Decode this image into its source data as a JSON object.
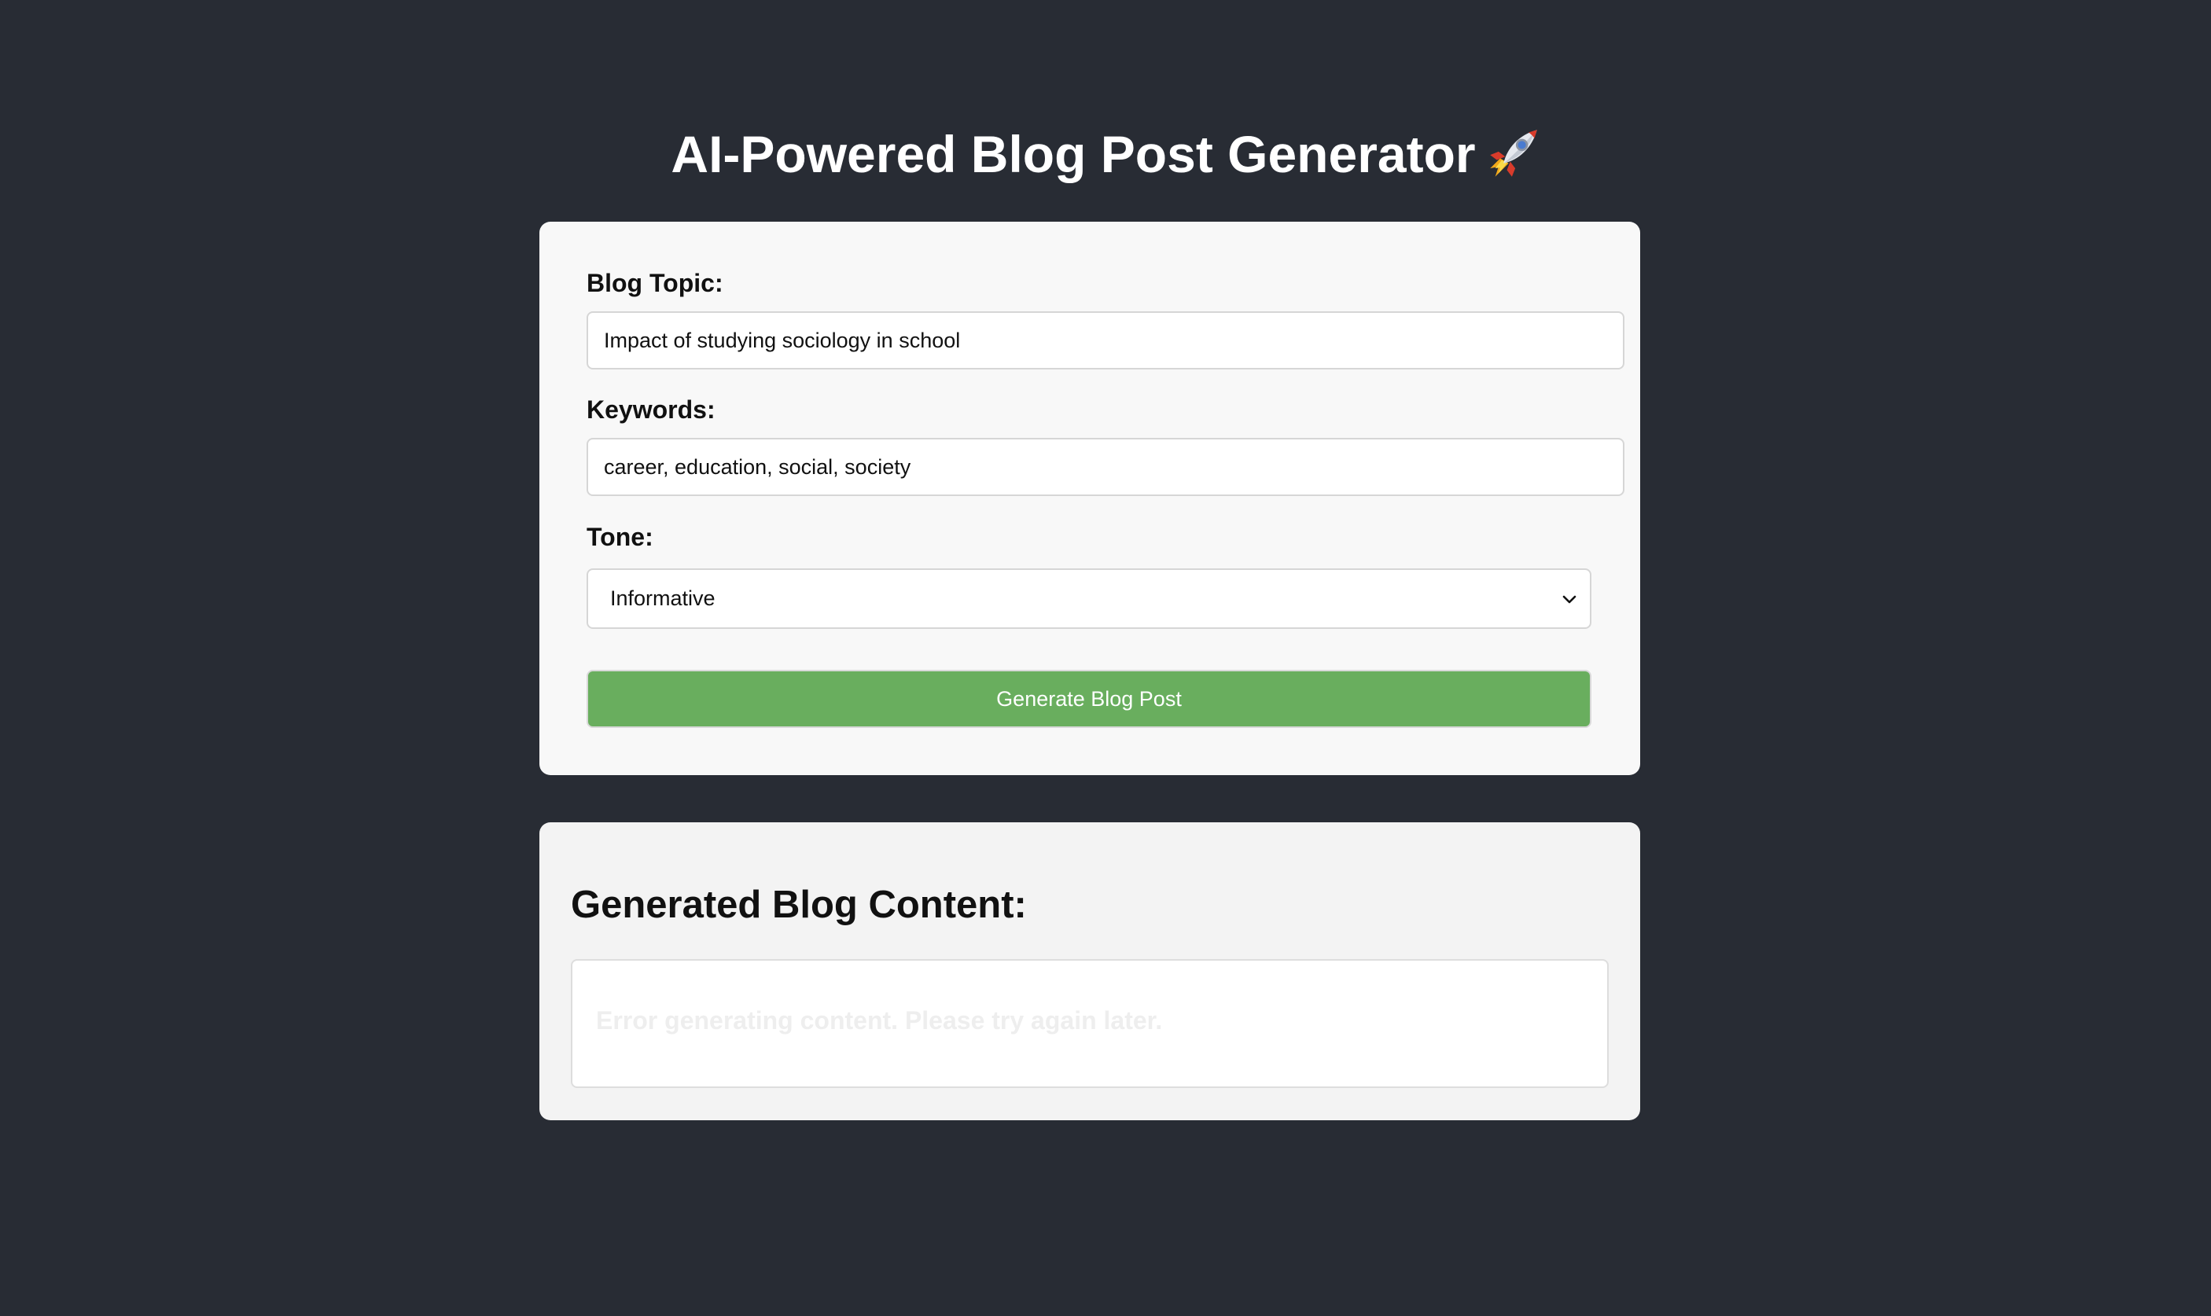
{
  "header": {
    "title": "AI-Powered Blog Post Generator",
    "title_icon": "rocket-icon"
  },
  "form": {
    "topic": {
      "label": "Blog Topic:",
      "value": "Impact of studying sociology in school"
    },
    "keywords": {
      "label": "Keywords:",
      "value": "career, education, social, society"
    },
    "tone": {
      "label": "Tone:",
      "selected": "Informative"
    },
    "generate_label": "Generate Blog Post"
  },
  "output": {
    "heading": "Generated Blog Content:",
    "message": "Error generating content. Please try again later."
  },
  "colors": {
    "page_background": "#282c34",
    "button": "#69ae5e",
    "card": "#f8f8f8",
    "output_card": "#f3f3f3"
  }
}
